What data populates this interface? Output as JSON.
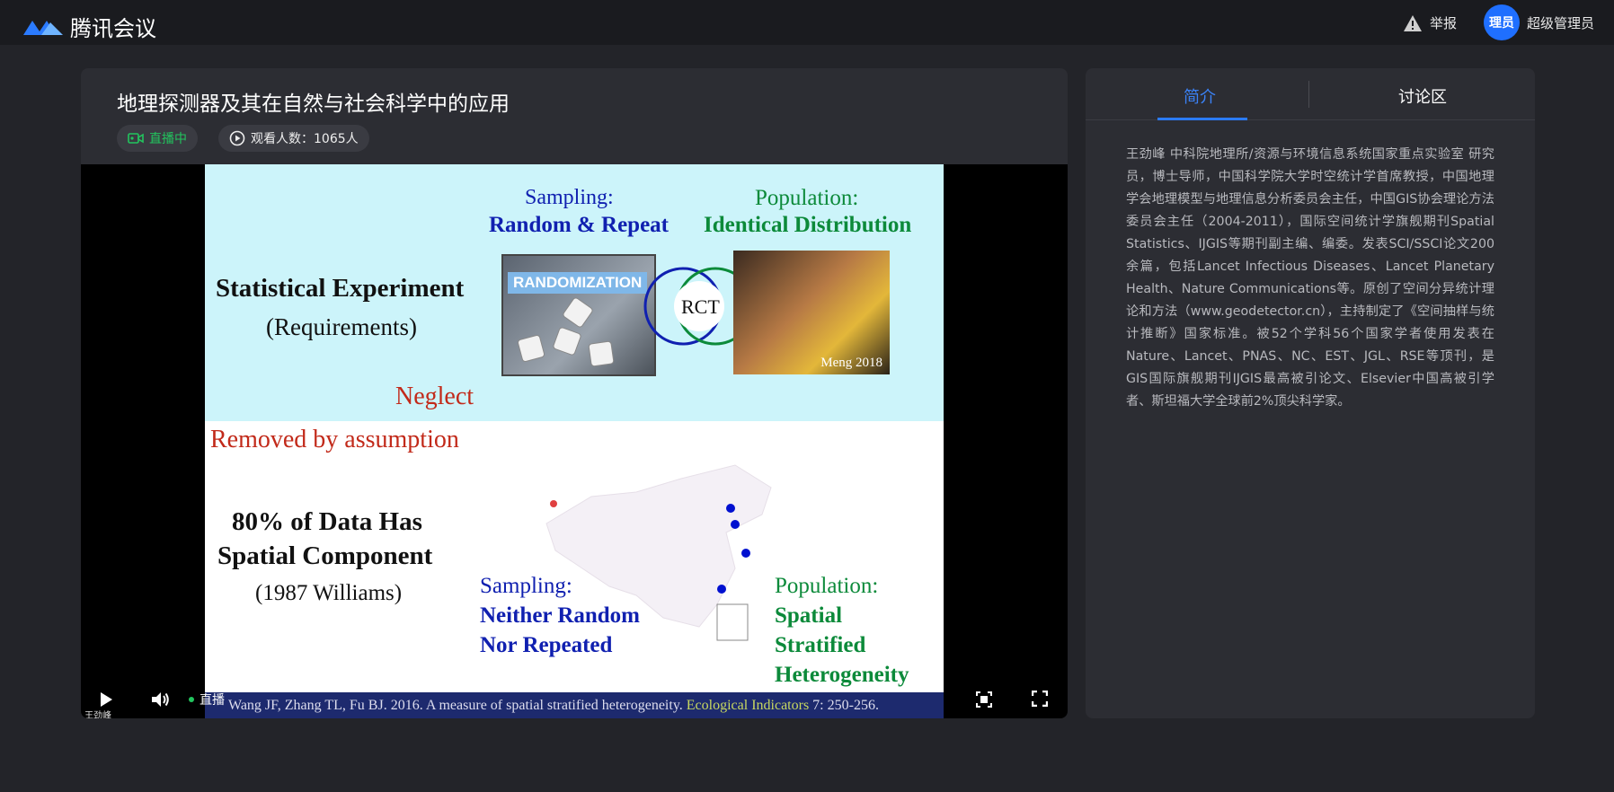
{
  "app": {
    "name": "腾讯会议"
  },
  "topbar": {
    "report_label": "举报",
    "avatar_text": "理员",
    "user_name": "超级管理员"
  },
  "meeting": {
    "title": "地理探测器及其在自然与社会科学中的应用",
    "live_status": "直播中",
    "viewers": "观看人数：1065人"
  },
  "slide": {
    "sampling_top": "Sampling:",
    "random_repeat": "Random & Repeat",
    "population_top": "Population:",
    "identical": "Identical Distribution",
    "stat_exp": "Statistical Experiment",
    "requirements": "(Requirements)",
    "randomization": "RANDOMIZATION",
    "rct": "RCT",
    "meng": "Meng 2018",
    "neglect": "Neglect",
    "removed": "Removed by assumption",
    "data80_1": "80% of Data Has",
    "data80_2": "Spatial Component",
    "williams": "(1987 Williams)",
    "sampling_bottom": "Sampling:",
    "neither": "Neither Random",
    "nor": "Nor Repeated",
    "population_bottom": "Population:",
    "spatial": "Spatial",
    "stratified": "Stratified",
    "heterogeneity": "Heterogeneity",
    "reference": "Wang JF, Zhang TL, Fu BJ. 2016. A measure of spatial stratified heterogeneity.",
    "journal": "Ecological Indicators",
    "pages": "7: 250-256."
  },
  "player": {
    "live_label": "直播",
    "speaker": "王劲峰"
  },
  "side": {
    "tab_intro": "简介",
    "tab_discussion": "讨论区",
    "intro_text": "王劲峰 中科院地理所/资源与环境信息系统国家重点实验室 研究员，博士导师，中国科学院大学时空统计学首席教授，中国地理学会地理模型与地理信息分析委员会主任，中国GIS协会理论方法委员会主任（2004-2011），国际空间统计学旗舰期刊Spatial Statistics、IJGIS等期刊副主编、编委。发表SCI/SSCI论文200余篇，包括Lancet Infectious Diseases、Lancet Planetary Health、Nature Communications等。原创了空间分异统计理论和方法（www.geodetector.cn），主持制定了《空间抽样与统计推断》国家标准。被52个学科56个国家学者使用发表在Nature、Lancet、PNAS、NC、EST、JGL、RSE等顶刊，是GIS国际旗舰期刊IJGIS最高被引论文、Elsevier中国高被引学者、斯坦福大学全球前2%顶尖科学家。"
  },
  "colors": {
    "accent": "#2b7bff",
    "live": "#22c55e"
  }
}
